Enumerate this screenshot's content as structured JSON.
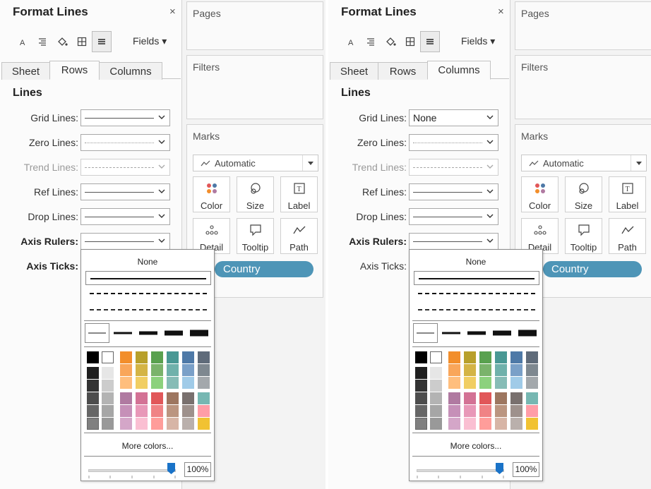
{
  "panels": [
    {
      "title": "Format Lines",
      "close": "×",
      "toolbar": {
        "icons": [
          "font-icon",
          "align-icon",
          "shading-icon",
          "borders-icon",
          "lines-icon"
        ],
        "fields_label": "Fields ▾"
      },
      "tabs": [
        "Sheet",
        "Rows",
        "Columns"
      ],
      "active_tab": "Rows",
      "section": "Lines",
      "rows": [
        {
          "label": "Grid Lines:",
          "value": "",
          "style": "solid"
        },
        {
          "label": "Zero Lines:",
          "value": "",
          "style": "dotted"
        },
        {
          "label": "Trend Lines:",
          "value": "",
          "style": "dashed",
          "disabled": true
        },
        {
          "label": "Ref Lines:",
          "value": "",
          "style": "solid"
        },
        {
          "label": "Drop Lines:",
          "value": "",
          "style": "solid"
        },
        {
          "label": "Axis Rulers:",
          "value": "",
          "style": "solid",
          "bold": true
        },
        {
          "label": "Axis Ticks:",
          "value": "",
          "style": "none",
          "bold": true
        }
      ],
      "cards": {
        "pages": "Pages",
        "filters": "Filters",
        "marks": "Marks"
      },
      "marks": {
        "type": "Automatic",
        "buttons": [
          "Color",
          "Size",
          "Label",
          "Detail",
          "Tooltip",
          "Path"
        ]
      },
      "pill": "Country",
      "popup": {
        "none_label": "None",
        "more_colors": "More colors...",
        "opacity": "100%"
      }
    },
    {
      "title": "Format Lines",
      "close": "×",
      "toolbar": {
        "icons": [
          "font-icon",
          "align-icon",
          "shading-icon",
          "borders-icon",
          "lines-icon"
        ],
        "fields_label": "Fields ▾"
      },
      "tabs": [
        "Sheet",
        "Rows",
        "Columns"
      ],
      "active_tab": "Columns",
      "section": "Lines",
      "rows": [
        {
          "label": "Grid Lines:",
          "value": "None",
          "style": "text"
        },
        {
          "label": "Zero Lines:",
          "value": "",
          "style": "dotted"
        },
        {
          "label": "Trend Lines:",
          "value": "",
          "style": "dashed",
          "disabled": true
        },
        {
          "label": "Ref Lines:",
          "value": "",
          "style": "solid"
        },
        {
          "label": "Drop Lines:",
          "value": "",
          "style": "solid"
        },
        {
          "label": "Axis Rulers:",
          "value": "",
          "style": "solid",
          "bold": true
        },
        {
          "label": "Axis Ticks:",
          "value": "",
          "style": "none",
          "bold": false
        }
      ],
      "cards": {
        "pages": "Pages",
        "filters": "Filters",
        "marks": "Marks"
      },
      "marks": {
        "type": "Automatic",
        "buttons": [
          "Color",
          "Size",
          "Label",
          "Detail",
          "Tooltip",
          "Path"
        ]
      },
      "pill": "Country",
      "popup": {
        "none_label": "None",
        "more_colors": "More colors...",
        "opacity": "100%"
      }
    }
  ],
  "colors": {
    "pill": "#4e95b7",
    "slider_thumb": "#1a73c8",
    "palette_gray_col1": [
      "#000000",
      "#1f1f1f",
      "#333333",
      "#4d4d4d",
      "#666666",
      "#808080"
    ],
    "palette_gray_col2": [
      "#ffffff",
      "#e6e6e6",
      "#cccccc",
      "#b3b3b3",
      "#a6a6a6",
      "#999999"
    ],
    "palette_top_rows": [
      [
        "#f28e2b",
        "#b8a02b",
        "#59a14f",
        "#499894",
        "#4e79a7",
        "#5f6b7a"
      ],
      [
        "#f9a65a",
        "#d4b445",
        "#7ab36b",
        "#6fb1ab",
        "#7aa0c8",
        "#7e8890"
      ],
      [
        "#ffbe7d",
        "#f1ce63",
        "#8cd17d",
        "#86bcb6",
        "#a0cbe8",
        "#a3a8ac"
      ]
    ],
    "palette_bottom_rows": [
      [
        "#b07aa1",
        "#d37295",
        "#e15759",
        "#9d7660",
        "#79706e",
        "#76b7b2"
      ],
      [
        "#c690b8",
        "#e898b8",
        "#f08385",
        "#bb9580",
        "#9e918c",
        "#ff9da7"
      ],
      [
        "#d4a6c8",
        "#fabfd2",
        "#ff9d9a",
        "#d7b5a6",
        "#bab0ac",
        "#f1c232"
      ]
    ]
  }
}
